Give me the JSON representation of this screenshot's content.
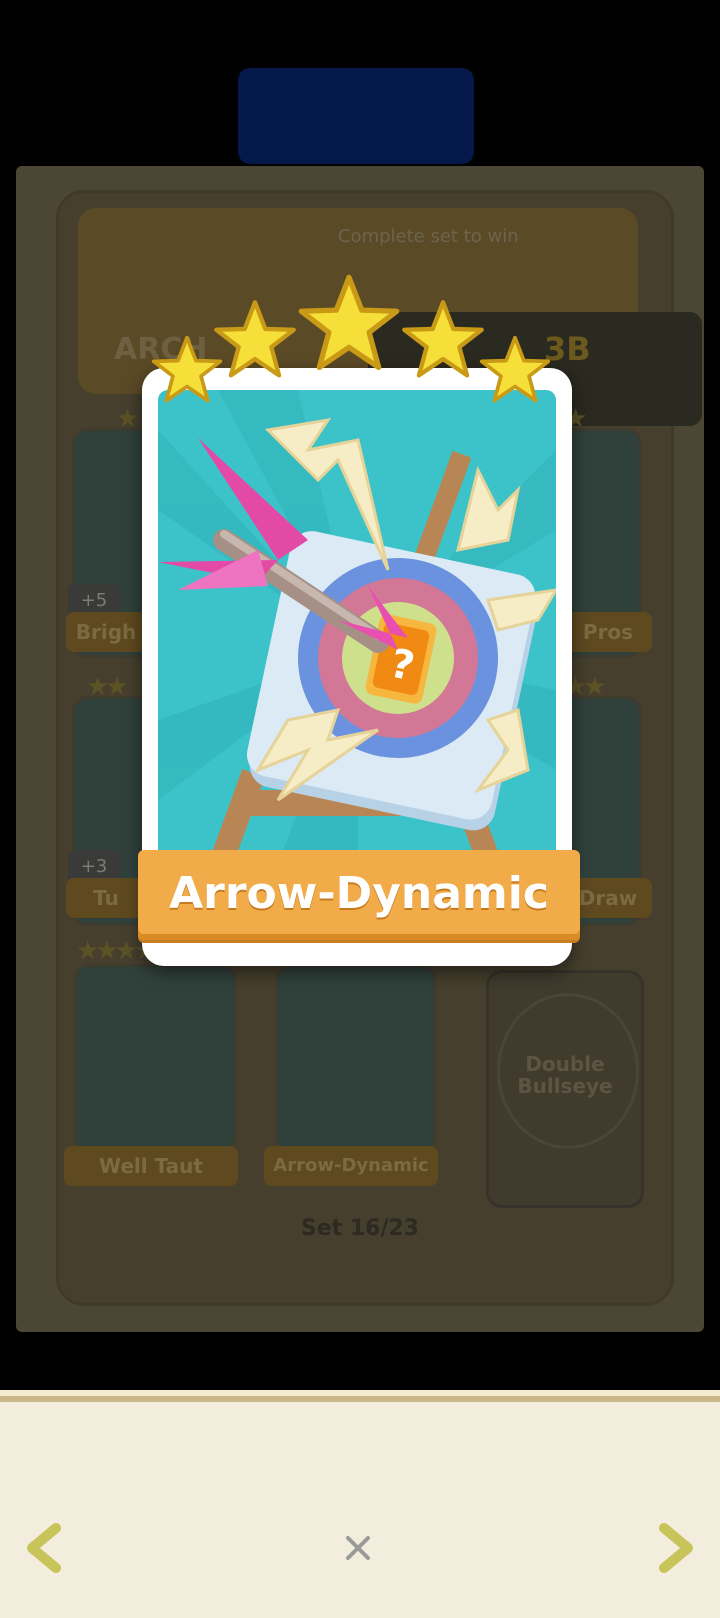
{
  "card": {
    "title": "Arrow-Dynamic",
    "star_rating": 5,
    "art_colors": {
      "sky": "#3cc3c9",
      "banner": "#f1ab49"
    }
  },
  "background_album": {
    "hint": "Complete set to win",
    "hero_name": "ARCH",
    "prize_amount": "3B",
    "set_label": "Set 16/23",
    "visible_cards": [
      {
        "name": "Brigh",
        "plus": "+5"
      },
      {
        "name": "Pros"
      },
      {
        "name": "Tu",
        "plus": "+3"
      },
      {
        "name": "Draw"
      },
      {
        "name": "Well Taut"
      },
      {
        "name": "Arrow-Dynamic"
      },
      {
        "name": "Double Bullseye",
        "locked": true
      }
    ]
  },
  "nav": {
    "prev_icon": "chevron-left-icon",
    "next_icon": "chevron-right-icon",
    "close_icon": "close-icon",
    "accent": "#c7c45a"
  }
}
